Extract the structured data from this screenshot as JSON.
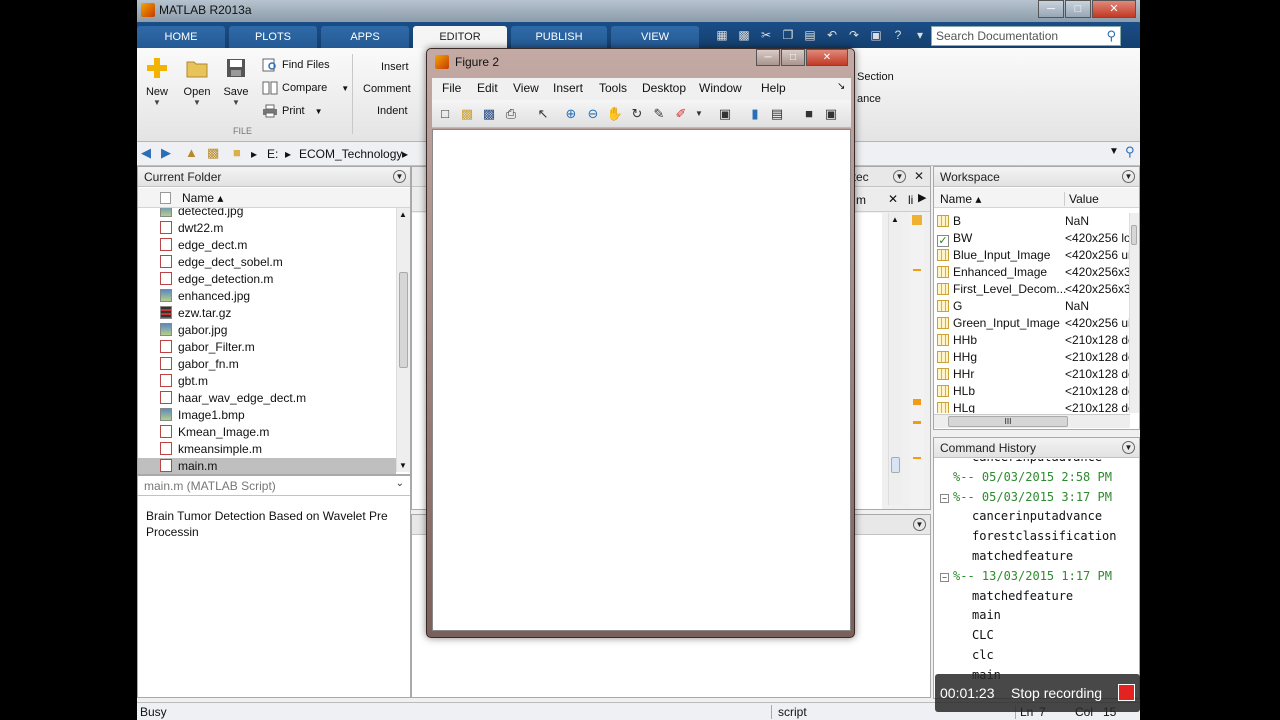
{
  "window": {
    "title": "MATLAB R2013a"
  },
  "ribbon": {
    "tabs": [
      "HOME",
      "PLOTS",
      "APPS",
      "EDITOR",
      "PUBLISH",
      "VIEW"
    ],
    "new_label": "New",
    "open_label": "Open",
    "save_label": "Save",
    "find_files_label": "Find Files",
    "compare_label": "Compare",
    "print_label": "Print",
    "file_group_label": "FILE",
    "insert_label": "Insert",
    "comment_label": "Comment",
    "indent_label": "Indent",
    "section_label": "Section",
    "advance_label": "ance"
  },
  "search": {
    "placeholder": "Search Documentation"
  },
  "address": {
    "drive": "E:",
    "separator": "▸",
    "folder": "ECOM_Technology"
  },
  "current_folder": {
    "title": "Current Folder",
    "column_name": "Name ▴",
    "files": [
      "detected.jpg",
      "dwt22.m",
      "edge_dect.m",
      "edge_dect_sobel.m",
      "edge_detection.m",
      "enhanced.jpg",
      "ezw.tar.gz",
      "gabor.jpg",
      "gabor_Filter.m",
      "gabor_fn.m",
      "gbt.m",
      "haar_wav_edge_dect.m",
      "Image1.bmp",
      "Kmean_Image.m",
      "kmeansimple.m",
      "main.m"
    ],
    "selected_file": "main.m"
  },
  "details": {
    "title": "main.m (MATLAB Script)",
    "description": "Brain Tumor Detection Based on Wavelet Pre Processin"
  },
  "editor_panel": {
    "tab_fragment": "etec",
    "tab2_fragment": "m",
    "tab3_fragment": "li"
  },
  "workspace": {
    "title": "Workspace",
    "col_name": "Name ▴",
    "col_value": "Value",
    "vars": [
      {
        "name": "B",
        "value": "NaN",
        "check": false
      },
      {
        "name": "BW",
        "value": "<420x256 lo",
        "check": true
      },
      {
        "name": "Blue_Input_Image",
        "value": "<420x256 ui",
        "check": false
      },
      {
        "name": "Enhanced_Image",
        "value": "<420x256x3",
        "check": false
      },
      {
        "name": "First_Level_Decom...",
        "value": "<420x256x3",
        "check": false
      },
      {
        "name": "G",
        "value": "NaN",
        "check": false
      },
      {
        "name": "Green_Input_Image",
        "value": "<420x256 ui",
        "check": false
      },
      {
        "name": "HHb",
        "value": "<210x128 dc",
        "check": false
      },
      {
        "name": "HHg",
        "value": "<210x128 dc",
        "check": false
      },
      {
        "name": "HHr",
        "value": "<210x128 dc",
        "check": false
      },
      {
        "name": "HLb",
        "value": "<210x128 dc",
        "check": false
      },
      {
        "name": "HLg",
        "value": "<210x128 dc",
        "check": false
      }
    ],
    "hscroll_marker": "III"
  },
  "history": {
    "title": "Command History",
    "entries": [
      {
        "text": "cancerinputadvance",
        "type": "cmd"
      },
      {
        "text": "%-- 05/03/2015 2:58 PM",
        "type": "ts",
        "exp": false
      },
      {
        "text": "%-- 05/03/2015 3:17 PM",
        "type": "ts",
        "exp": true
      },
      {
        "text": "cancerinputadvance",
        "type": "cmd"
      },
      {
        "text": "forestclassification",
        "type": "cmd"
      },
      {
        "text": "matchedfeature",
        "type": "cmd"
      },
      {
        "text": "%-- 13/03/2015 1:17 PM",
        "type": "ts",
        "exp": true
      },
      {
        "text": "matchedfeature",
        "type": "cmd"
      },
      {
        "text": "main",
        "type": "cmd"
      },
      {
        "text": "CLC",
        "type": "cmd"
      },
      {
        "text": "clc",
        "type": "cmd"
      },
      {
        "text": "main",
        "type": "cmd"
      }
    ]
  },
  "figure": {
    "title": "Figure 2",
    "menu": [
      "File",
      "Edit",
      "View",
      "Insert",
      "Tools",
      "Desktop",
      "Window",
      "Help"
    ]
  },
  "status": {
    "state": "Busy",
    "mode": "script",
    "ln_label": "Ln",
    "ln_value": "7",
    "col_label": "Col",
    "col_value": "15"
  },
  "recording": {
    "time": "00:01:23",
    "label": "Stop recording"
  },
  "colors": {
    "ribbon_tab_bar": "#1b4d87",
    "timestamp_green": "#2e8b2e",
    "record_red": "#e32222",
    "figure_frame": "#c4aaa4"
  }
}
